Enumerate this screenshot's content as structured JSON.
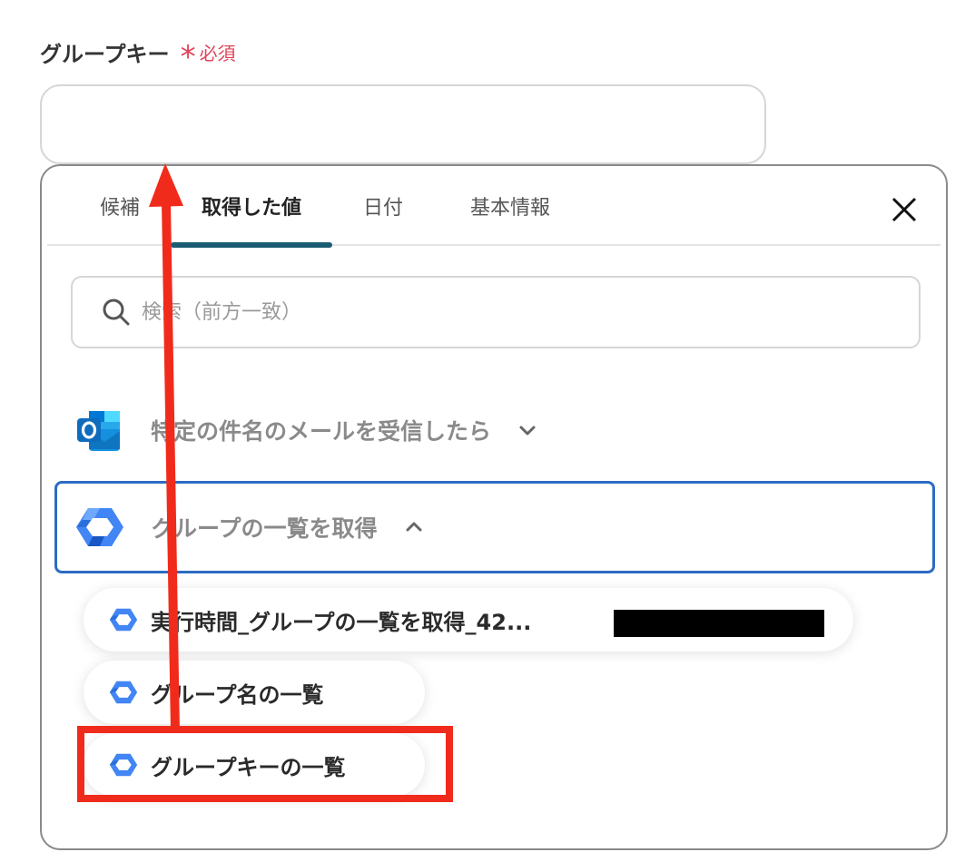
{
  "field": {
    "label": "グループキー",
    "required_mark": "*",
    "required_text": "必須",
    "value": ""
  },
  "tabs": [
    {
      "label": "候補",
      "active": false
    },
    {
      "label": "取得した値",
      "active": true
    },
    {
      "label": "日付",
      "active": false
    },
    {
      "label": "基本情報",
      "active": false
    }
  ],
  "search": {
    "placeholder": "検索（前方一致）"
  },
  "sections": [
    {
      "label": "特定の件名のメールを受信したら",
      "icon": "outlook-icon",
      "expanded": false
    },
    {
      "label": "グループの一覧を取得",
      "icon": "google-workspace-icon",
      "expanded": true
    }
  ],
  "items": [
    {
      "label": "実行時間_グループの一覧を取得_42...",
      "icon": "google-workspace-icon"
    },
    {
      "label": "グループ名の一覧",
      "icon": "google-workspace-icon"
    },
    {
      "label": "グループキーの一覧",
      "icon": "google-workspace-icon"
    }
  ],
  "colors": {
    "accent_tab": "#1c5c72",
    "selected_border": "#2d6cc2",
    "required": "#e0435a",
    "annotation": "#f12b1b"
  }
}
